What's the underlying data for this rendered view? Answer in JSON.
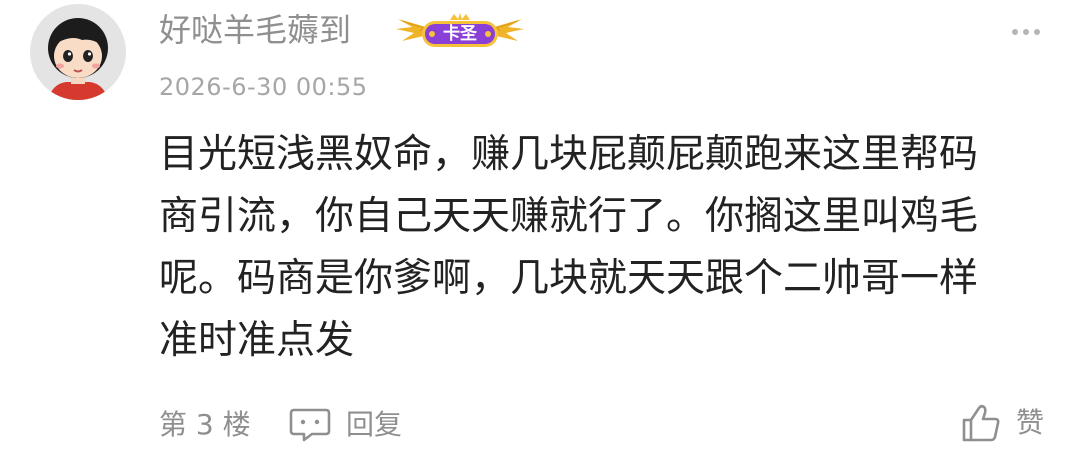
{
  "comment": {
    "author": {
      "name": "好哒羊毛薅到",
      "badge_text": "卡圣",
      "avatar": "cartoon-girl-avatar"
    },
    "timestamp": "2026-6-30 00:55",
    "body_lines": [
      "目光短浅黑奴命，赚几块屁颠屁颠跑来这里帮码",
      "商引流，你自己天天赚就行了。你搁这里叫鸡毛",
      "呢。码商是你爹啊，几块就天天跟个二帅哥一样",
      "准时准点发"
    ],
    "floor_label": "第 3 楼",
    "reply_label": "回复",
    "like_label": "赞"
  },
  "icons": {
    "more": "more-dots-icon",
    "reply": "comment-bubble-icon",
    "like": "thumbs-up-icon"
  },
  "colors": {
    "meta_text": "#8f8f8f",
    "body_text": "#222222",
    "badge_purple": "#8a3fd6",
    "badge_gold": "#f0b429"
  }
}
